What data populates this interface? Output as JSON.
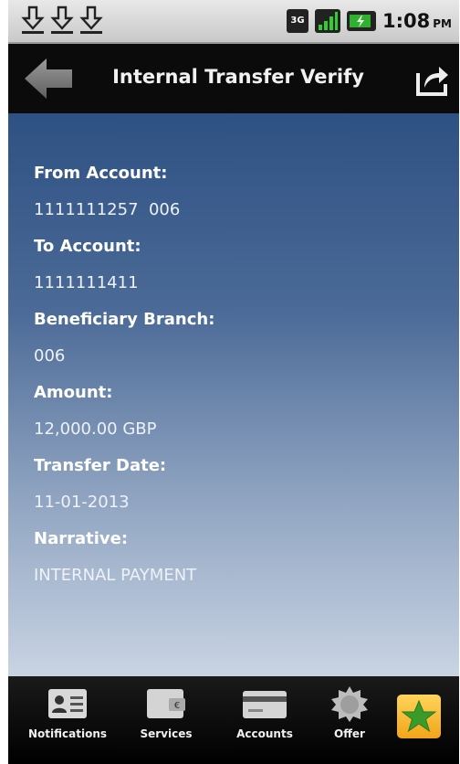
{
  "status_bar": {
    "network": "3G",
    "time": "1:08",
    "ampm": "PM",
    "download_icons": [
      "download-icon",
      "download-icon",
      "download-icon"
    ]
  },
  "title_bar": {
    "title": "Internal Transfer Verify",
    "back_icon": "back-arrow-icon",
    "share_icon": "share-icon"
  },
  "details": {
    "from_account_label": "From Account:",
    "from_account_value": "1111111257  006",
    "to_account_label": "To Account:",
    "to_account_value": "1111111411",
    "beneficiary_branch_label": "Beneficiary Branch:",
    "beneficiary_branch_value": "006",
    "amount_label": "Amount:",
    "amount_value": "12,000.00 GBP",
    "transfer_date_label": "Transfer Date:",
    "transfer_date_value": "11-01-2013",
    "narrative_label": "Narrative:",
    "narrative_value": "INTERNAL PAYMENT"
  },
  "tab_bar": {
    "tabs": [
      {
        "label": "Notifications",
        "icon": "contact-card-icon"
      },
      {
        "label": "Services",
        "icon": "wallet-icon"
      },
      {
        "label": "Accounts",
        "icon": "credit-card-icon"
      },
      {
        "label": "Offer",
        "icon": "gear-badge-icon"
      }
    ],
    "favorite_icon": "star-icon"
  },
  "colors": {
    "content_top": "#2e5183",
    "content_bottom": "#c9d4e3",
    "favorite_bg": "#f2a51a",
    "star": "#3a9b2a"
  }
}
